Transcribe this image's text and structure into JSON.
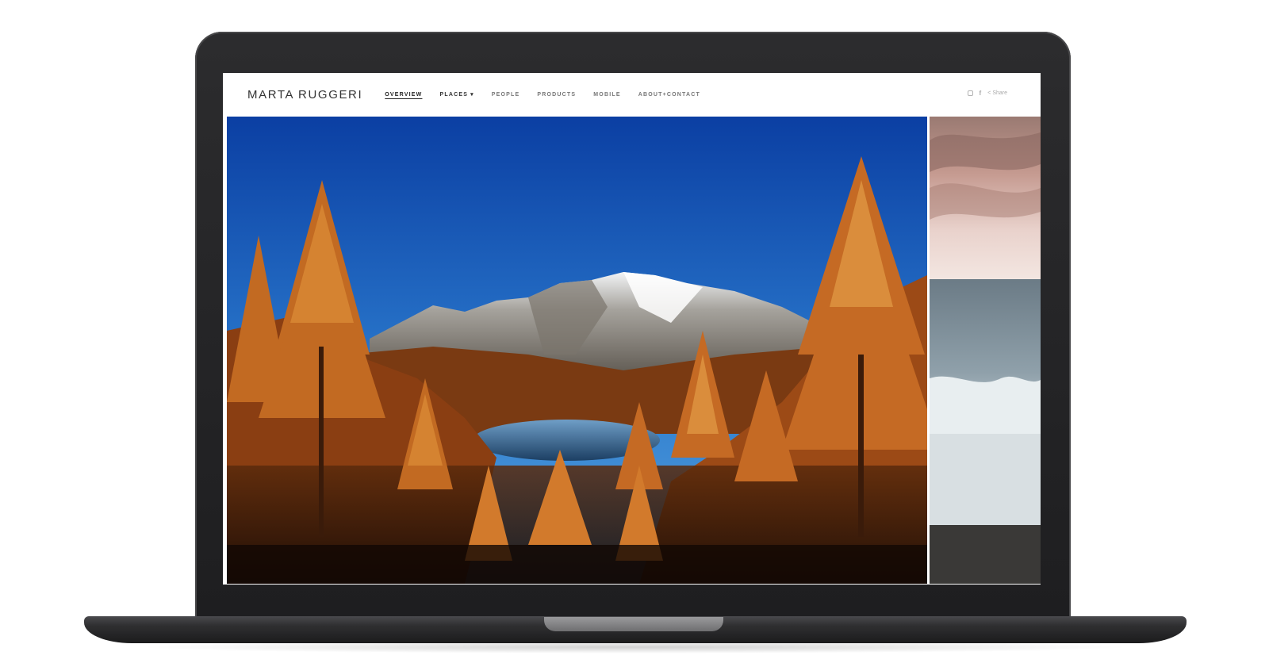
{
  "site": {
    "brand": "MARTA RUGGERI",
    "nav": [
      {
        "label": "OVERVIEW",
        "active": true
      },
      {
        "label": "PLACES",
        "dropdown": true
      },
      {
        "label": "PEOPLE"
      },
      {
        "label": "PRODUCTS"
      },
      {
        "label": "MOBILE"
      },
      {
        "label": "ABOUT+CONTACT"
      }
    ],
    "social": {
      "instagram_icon": "instagram-icon",
      "facebook_icon": "facebook-icon",
      "share_label": "Share"
    }
  },
  "colors": {
    "sky_top": "#0b3fa3",
    "sky_bottom": "#3b8fd6",
    "foliage": "#b8561b",
    "laptop": "#1e1e20"
  },
  "images": {
    "main": "autumn larch forest with alpine lake and snowy mountains",
    "side": "sea waves on a beach under a pink sky"
  }
}
